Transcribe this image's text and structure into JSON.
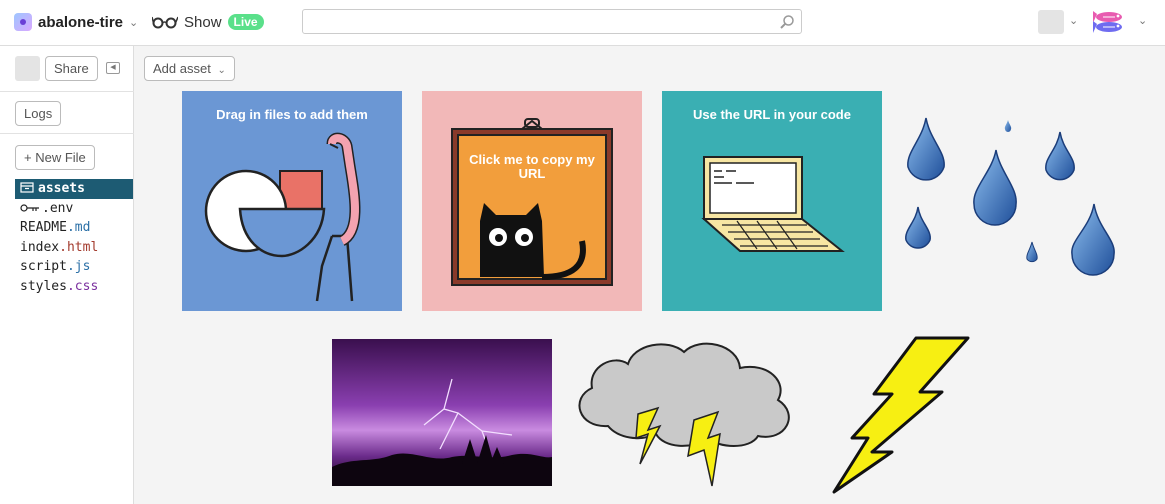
{
  "header": {
    "project_name": "abalone-tire",
    "show_label": "Show",
    "live_badge": "Live",
    "search_placeholder": ""
  },
  "sidebar": {
    "share_label": "Share",
    "logs_label": "Logs",
    "new_file_label": "+ New File",
    "files": [
      {
        "base": "assets",
        "ext": "",
        "icon": "folder-icon",
        "active": true
      },
      {
        "base": ".env",
        "ext": "",
        "icon": "key-icon",
        "active": false
      },
      {
        "base": "README",
        "ext": ".md",
        "active": false
      },
      {
        "base": "index",
        "ext": ".html",
        "active": false
      },
      {
        "base": "script",
        "ext": ".js",
        "active": false
      },
      {
        "base": "styles",
        "ext": ".css",
        "active": false
      }
    ]
  },
  "main": {
    "add_asset_label": "Add asset",
    "tiles": [
      {
        "title": "Drag in files to add them",
        "color": "#6b97d4"
      },
      {
        "title": "Click me to copy my URL",
        "color": "#f2b8b8",
        "frame_color": "#f29e3c"
      },
      {
        "title": "Use the URL in your code",
        "color": "#3aafb3"
      },
      {
        "title": "",
        "name": "raindrops"
      },
      {
        "title": "",
        "name": "purple-lightning-photo"
      },
      {
        "title": "",
        "name": "storm-cloud"
      },
      {
        "title": "",
        "name": "lightning-bolt"
      }
    ]
  },
  "colors": {
    "accent_live": "#5ae08a",
    "active_file_bg": "#1d5b73"
  }
}
